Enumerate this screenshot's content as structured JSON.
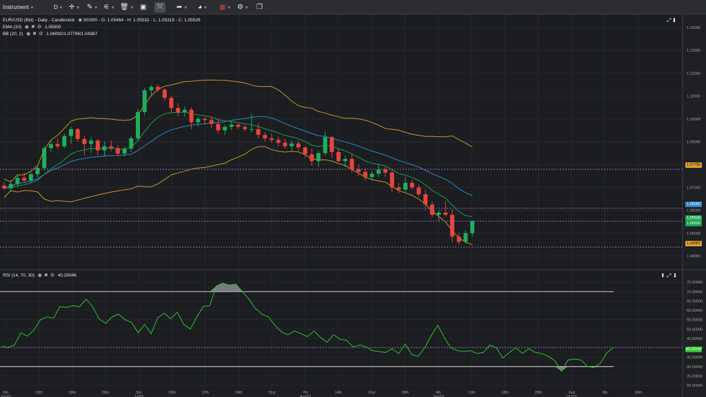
{
  "toolbar": {
    "instrument_label": "Instrument",
    "timeframe_label": "D",
    "icons": [
      "crosshair-icon",
      "pen-icon",
      "zigzag-icon",
      "trash-icon",
      "panel-icon",
      "fullscreen-icon",
      "share-icon",
      "palette-icon",
      "flag-icon",
      "settings-icon",
      "window-icon"
    ]
  },
  "main_legend": {
    "title": "EUR/USD (Bid) - Daily - Candlestick",
    "bars": "90/300",
    "ohlc": "O: 1.05464 - H: 1.05532 - L: 1.05315 - C: 1.05526",
    "ema_label": "EMA (10)",
    "ema_value": "1.05500",
    "bb_label": "BB (20, 2)",
    "bb_value": "1.06092/1.07796/1.04387"
  },
  "rsi_legend": {
    "label": "RSI (14, 70, 30)",
    "value": "40.20046"
  },
  "price_axis": [
    "1.14000",
    "1.13000",
    "1.12000",
    "1.11000",
    "1.10000",
    "1.09000",
    "1.08000",
    "1.07000",
    "1.06000",
    "1.05000",
    "1.04000"
  ],
  "price_tags": {
    "bb_upper": "1.07796",
    "bb_mid": "1.06092",
    "close": "1.05526",
    "ema": "1.05500",
    "bb_lower": "1.04387"
  },
  "rsi_axis": [
    "75.00000",
    "70.00000",
    "65.00000",
    "60.00000",
    "55.00000",
    "50.00000",
    "45.00000",
    "40.00000",
    "35.00000",
    "30.00000",
    "25.00000",
    "20.00000"
  ],
  "rsi_tag": "40.20046",
  "time_axis": [
    "5th\nJun23",
    "12th",
    "19th",
    "26th",
    "3rd\nJul23",
    "10th",
    "17th",
    "24th",
    "31st",
    "7th\nAug23",
    "14th",
    "21st",
    "28th",
    "4th\nSep23",
    "11th",
    "18th",
    "25th",
    "2nd\nOct23",
    "9th",
    "16th"
  ],
  "colors": {
    "bull": "#1fae5a",
    "bear": "#e8453c",
    "ema": "#1f9e4e",
    "bb_band": "#c9962c",
    "bb_mid": "#2e86c9",
    "rsi": "#2ec42e",
    "level_line": "#9a6cc4"
  },
  "chart_data": [
    {
      "type": "candlestick",
      "title": "EUR/USD (Bid) - Daily - Candlestick",
      "ylim": [
        1.04,
        1.143
      ],
      "y_ticks": [
        1.14,
        1.13,
        1.12,
        1.11,
        1.1,
        1.09,
        1.08,
        1.07,
        1.06,
        1.05,
        1.04
      ],
      "x_labels": [
        "5th Jun23",
        "12th",
        "19th",
        "26th",
        "3rd Jul23",
        "10th",
        "17th",
        "24th",
        "31st",
        "7th Aug23",
        "14th",
        "21st",
        "28th",
        "4th Sep23",
        "11th",
        "18th",
        "25th",
        "2nd Oct23",
        "9th",
        "16th"
      ],
      "candles": [
        [
          1.0708,
          1.0722,
          1.069,
          1.0696
        ],
        [
          1.0696,
          1.0732,
          1.068,
          1.0715
        ],
        [
          1.0715,
          1.075,
          1.07,
          1.0742
        ],
        [
          1.0742,
          1.0765,
          1.0722,
          1.073
        ],
        [
          1.073,
          1.077,
          1.0718,
          1.0758
        ],
        [
          1.0758,
          1.0795,
          1.0745,
          1.0785
        ],
        [
          1.0785,
          1.088,
          1.0775,
          1.0872
        ],
        [
          1.0872,
          1.0905,
          1.0855,
          1.089
        ],
        [
          1.089,
          1.0915,
          1.087,
          1.088
        ],
        [
          1.088,
          1.0935,
          1.0872,
          1.0925
        ],
        [
          1.0925,
          1.0965,
          1.089,
          1.0955
        ],
        [
          1.0955,
          1.096,
          1.09,
          1.0912
        ],
        [
          1.0912,
          1.0925,
          1.084,
          1.089
        ],
        [
          1.089,
          1.092,
          1.085,
          1.0905
        ],
        [
          1.0905,
          1.0912,
          1.084,
          1.0862
        ],
        [
          1.0862,
          1.09,
          1.0835,
          1.088
        ],
        [
          1.088,
          1.0905,
          1.0858,
          1.0872
        ],
        [
          1.0872,
          1.0885,
          1.0835,
          1.0848
        ],
        [
          1.0848,
          1.088,
          1.0835,
          1.087
        ],
        [
          1.087,
          1.0925,
          1.0855,
          1.0915
        ],
        [
          1.0915,
          1.1045,
          1.0905,
          1.103
        ],
        [
          1.103,
          1.1135,
          1.1015,
          1.1125
        ],
        [
          1.1125,
          1.1148,
          1.11,
          1.114
        ],
        [
          1.114,
          1.115,
          1.1118,
          1.1128
        ],
        [
          1.1128,
          1.1135,
          1.108,
          1.1092
        ],
        [
          1.1092,
          1.11,
          1.1025,
          1.1048
        ],
        [
          1.1048,
          1.107,
          1.101,
          1.103
        ],
        [
          1.103,
          1.1055,
          1.101,
          1.104
        ],
        [
          1.104,
          1.105,
          1.0955,
          1.0985
        ],
        [
          1.0985,
          1.101,
          1.0965,
          1.1
        ],
        [
          1.1,
          1.101,
          1.0975,
          1.0995
        ],
        [
          1.0995,
          1.101,
          1.096,
          1.0978
        ],
        [
          1.0978,
          1.1,
          1.0935,
          1.095
        ],
        [
          1.095,
          1.0975,
          1.093,
          1.0965
        ],
        [
          1.0965,
          1.099,
          1.095,
          1.0975
        ],
        [
          1.0975,
          1.098,
          1.0955,
          1.0965
        ],
        [
          1.0965,
          1.0972,
          1.0945,
          1.0955
        ],
        [
          1.0955,
          1.102,
          1.094,
          1.0955
        ],
        [
          1.0955,
          1.098,
          1.0915,
          1.093
        ],
        [
          1.093,
          1.0942,
          1.0902,
          1.0915
        ],
        [
          1.0915,
          1.0935,
          1.0895,
          1.0908
        ],
        [
          1.0908,
          1.0925,
          1.088,
          1.0895
        ],
        [
          1.0895,
          1.0912,
          1.087,
          1.088
        ],
        [
          1.088,
          1.0905,
          1.086,
          1.0892
        ],
        [
          1.0892,
          1.0905,
          1.086,
          1.0875
        ],
        [
          1.0875,
          1.088,
          1.083,
          1.0845
        ],
        [
          1.0845,
          1.087,
          1.0795,
          1.0815
        ],
        [
          1.0815,
          1.086,
          1.079,
          1.085
        ],
        [
          1.085,
          1.0945,
          1.084,
          1.092
        ],
        [
          1.092,
          1.0925,
          1.083,
          1.0855
        ],
        [
          1.0855,
          1.087,
          1.081,
          1.0815
        ],
        [
          1.0815,
          1.084,
          1.079,
          1.0825
        ],
        [
          1.0825,
          1.0845,
          1.0765,
          1.078
        ],
        [
          1.078,
          1.08,
          1.075,
          1.0768
        ],
        [
          1.0768,
          1.0785,
          1.073,
          1.0745
        ],
        [
          1.0745,
          1.0772,
          1.073,
          1.076
        ],
        [
          1.076,
          1.08,
          1.0745,
          1.0778
        ],
        [
          1.0778,
          1.079,
          1.0745,
          1.0765
        ],
        [
          1.0765,
          1.0775,
          1.068,
          1.07
        ],
        [
          1.07,
          1.072,
          1.0675,
          1.069
        ],
        [
          1.069,
          1.0745,
          1.068,
          1.072
        ],
        [
          1.072,
          1.0735,
          1.069,
          1.07
        ],
        [
          1.07,
          1.0712,
          1.066,
          1.067
        ],
        [
          1.067,
          1.069,
          1.06,
          1.0625
        ],
        [
          1.0625,
          1.064,
          1.057,
          1.058
        ],
        [
          1.058,
          1.06,
          1.055,
          1.059
        ],
        [
          1.059,
          1.064,
          1.0572,
          1.058
        ],
        [
          1.058,
          1.0602,
          1.046,
          1.0485
        ],
        [
          1.0485,
          1.05,
          1.045,
          1.0462
        ],
        [
          1.0462,
          1.0512,
          1.0455,
          1.05
        ],
        [
          1.05,
          1.0535,
          1.0485,
          1.05526
        ]
      ]
    },
    {
      "type": "line",
      "title": "RSI (14, 70, 30)",
      "ylim": [
        20,
        78
      ],
      "y_ticks": [
        75,
        70,
        65,
        60,
        55,
        50,
        45,
        40,
        35,
        30,
        25,
        20
      ],
      "levels": [
        70,
        30
      ],
      "series": [
        {
          "name": "RSI (14, 70, 30)",
          "values": [
            40.8,
            40.2,
            41.5,
            48.0,
            46.2,
            49.5,
            55.0,
            56.5,
            55.8,
            62.0,
            61.5,
            62.5,
            61.8,
            66.0,
            62.0,
            55.5,
            53.0,
            56.5,
            58.0,
            55.0,
            53.5,
            48.0,
            52.5,
            47.5,
            56.0,
            58.5,
            55.5,
            59.0,
            52.5,
            50.0,
            56.5,
            62.0,
            62.5,
            73.0,
            74.5,
            73.5,
            74.0,
            70.0,
            66.0,
            61.0,
            58.0,
            56.5,
            52.0,
            48.5,
            47.0,
            49.0,
            47.5,
            46.0,
            49.0,
            45.5,
            43.0,
            47.0,
            44.5,
            44.0,
            40.5,
            41.5,
            40.5,
            38.5,
            38.0,
            37.5,
            39.5,
            37.0,
            42.0,
            36.5,
            35.5,
            40.0,
            46.5,
            52.0,
            45.5,
            40.0,
            38.5,
            38.0,
            38.5,
            37.0,
            37.5,
            41.5,
            40.0,
            34.5,
            37.5,
            40.0,
            37.0,
            39.5,
            37.5,
            37.0,
            35.5,
            33.0,
            27.5,
            33.5,
            34.0,
            33.5,
            30.0,
            29.5,
            32.0,
            37.5,
            40.2
          ]
        }
      ]
    }
  ]
}
